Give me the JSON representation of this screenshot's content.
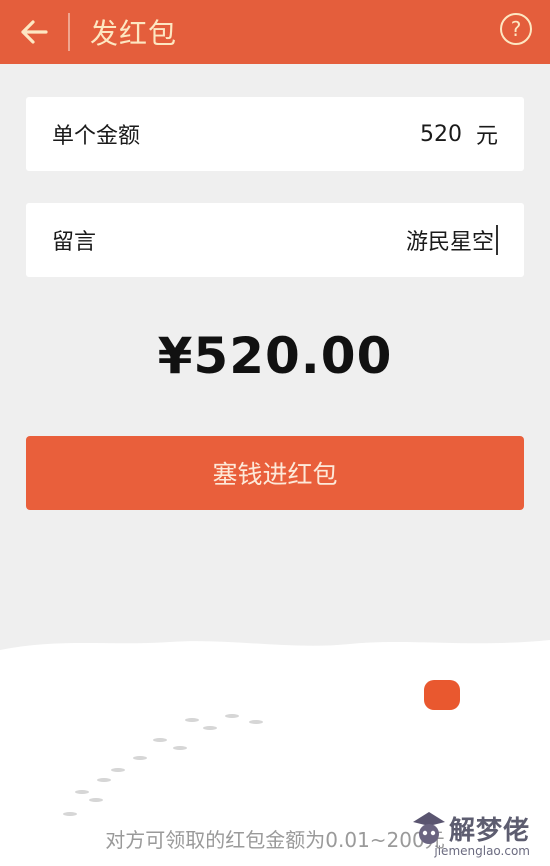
{
  "header": {
    "back_icon": "arrow-left-icon",
    "title": "发红包",
    "help_icon": "question-circle-icon",
    "help_label": "?"
  },
  "amount_field": {
    "label": "单个金额",
    "value": "520",
    "unit": "元"
  },
  "message_field": {
    "label": "留言",
    "value": "游民星空"
  },
  "total": "¥520.00",
  "submit_label": "塞钱进红包",
  "footnote": "对方可领取的红包金额为0.01~200元",
  "watermark": {
    "text": "解梦佬",
    "sub": "jiemenglao.com"
  },
  "colors": {
    "header_bg": "#e45e3c",
    "header_text": "#fde7c2",
    "button_bg": "#e95f3b",
    "page_bg": "#efefef"
  }
}
